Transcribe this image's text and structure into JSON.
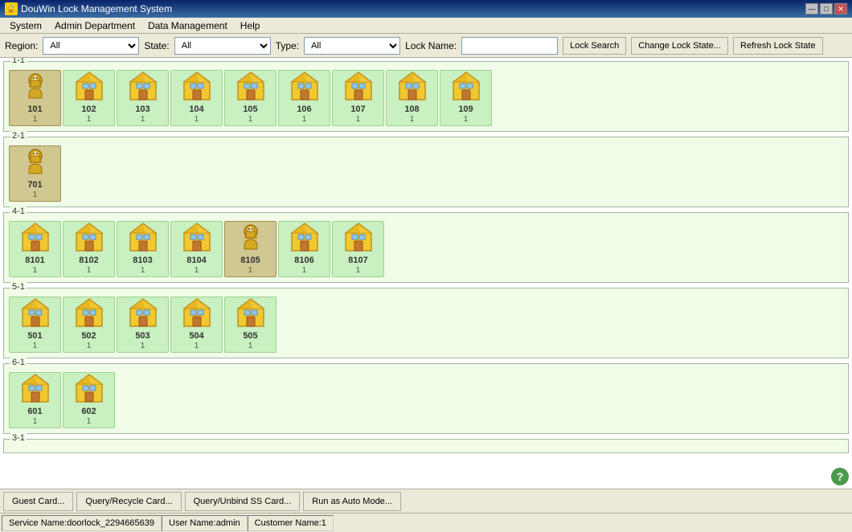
{
  "titlebar": {
    "title": "DouWin Lock Management System",
    "min_label": "—",
    "max_label": "□",
    "close_label": "✕"
  },
  "menu": {
    "items": [
      "System",
      "Admin Department",
      "Data Management",
      "Help"
    ]
  },
  "toolbar": {
    "region_label": "Region:",
    "region_value": "All",
    "state_label": "State:",
    "state_value": "All",
    "type_label": "Type:",
    "type_value": "All",
    "lock_name_label": "Lock Name:",
    "lock_name_placeholder": "",
    "lock_search_btn": "Lock Search",
    "change_lock_state_btn": "Change Lock State...",
    "refresh_lock_state_btn": "Refresh Lock State"
  },
  "sections": [
    {
      "id": "1-1",
      "label": "1-1",
      "locks": [
        {
          "num": "101",
          "sub": "1",
          "selected": true
        },
        {
          "num": "102",
          "sub": "1",
          "selected": false
        },
        {
          "num": "103",
          "sub": "1",
          "selected": false
        },
        {
          "num": "104",
          "sub": "1",
          "selected": false
        },
        {
          "num": "105",
          "sub": "1",
          "selected": false
        },
        {
          "num": "106",
          "sub": "1",
          "selected": false
        },
        {
          "num": "107",
          "sub": "1",
          "selected": false
        },
        {
          "num": "108",
          "sub": "1",
          "selected": false
        },
        {
          "num": "109",
          "sub": "1",
          "selected": false
        }
      ]
    },
    {
      "id": "2-1",
      "label": "2-1",
      "locks": [
        {
          "num": "701",
          "sub": "1",
          "selected": true
        }
      ]
    },
    {
      "id": "4-1",
      "label": "4-1",
      "locks": [
        {
          "num": "8101",
          "sub": "1",
          "selected": false
        },
        {
          "num": "8102",
          "sub": "1",
          "selected": false
        },
        {
          "num": "8103",
          "sub": "1",
          "selected": false
        },
        {
          "num": "8104",
          "sub": "1",
          "selected": false
        },
        {
          "num": "8105",
          "sub": "1",
          "selected": true
        },
        {
          "num": "8106",
          "sub": "1",
          "selected": false
        },
        {
          "num": "8107",
          "sub": "1",
          "selected": false
        }
      ]
    },
    {
      "id": "5-1",
      "label": "5-1",
      "locks": [
        {
          "num": "501",
          "sub": "1",
          "selected": false
        },
        {
          "num": "502",
          "sub": "1",
          "selected": false
        },
        {
          "num": "503",
          "sub": "1",
          "selected": false
        },
        {
          "num": "504",
          "sub": "1",
          "selected": false
        },
        {
          "num": "505",
          "sub": "1",
          "selected": false
        }
      ]
    },
    {
      "id": "6-1",
      "label": "6-1",
      "locks": [
        {
          "num": "601",
          "sub": "1",
          "selected": false
        },
        {
          "num": "602",
          "sub": "1",
          "selected": false
        }
      ]
    },
    {
      "id": "3-1",
      "label": "3-1",
      "locks": []
    }
  ],
  "bottom_buttons": [
    "Guest Card...",
    "Query/Recycle Card...",
    "Query/Unbind SS Card...",
    "Run as Auto Mode..."
  ],
  "statusbar": {
    "service": "Service Name:doorlock_2294665639",
    "user": "User Name:admin",
    "customer": "Customer Name:1"
  }
}
